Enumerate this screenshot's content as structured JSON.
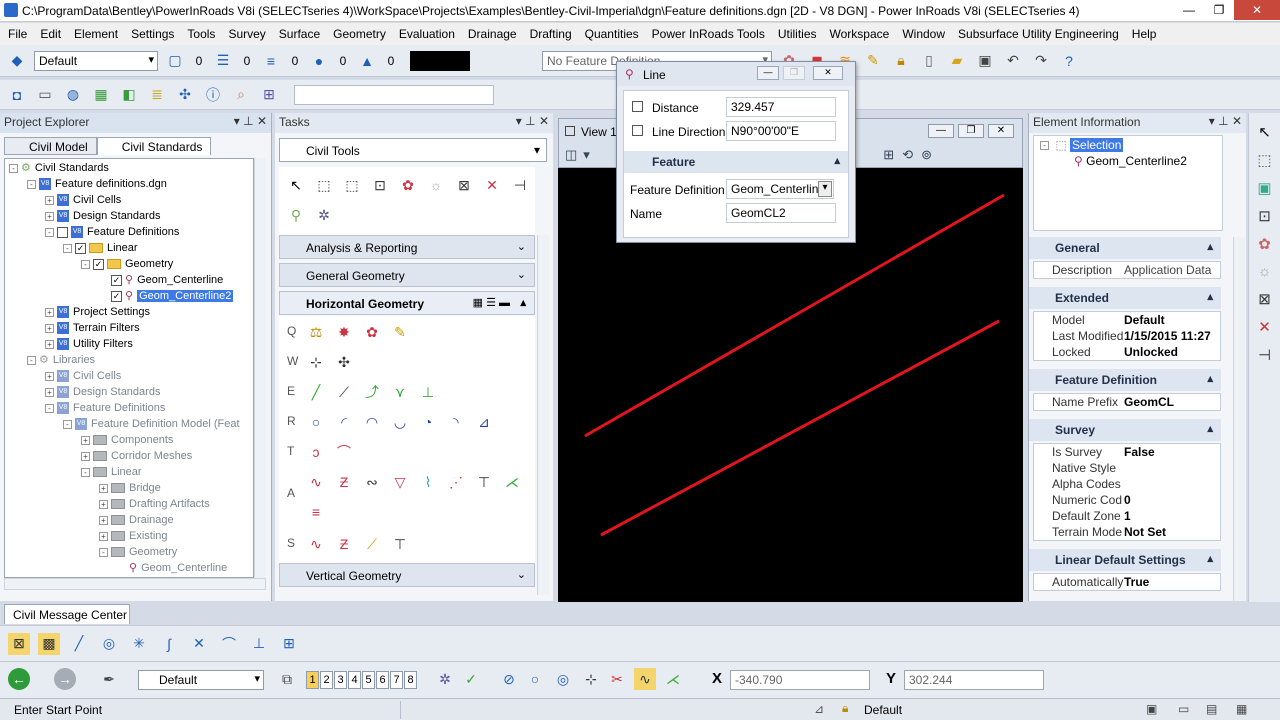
{
  "window": {
    "title": "C:\\ProgramData\\Bentley\\PowerInRoads V8i (SELECTseries 4)\\WorkSpace\\Projects\\Examples\\Bentley-Civil-Imperial\\dgn\\Feature definitions.dgn [2D - V8 DGN] - Power InRoads V8i (SELECTseries 4)",
    "minimize": "—",
    "maximize": "❐",
    "close": "✕"
  },
  "menu": [
    "File",
    "Edit",
    "Element",
    "Settings",
    "Tools",
    "Survey",
    "Surface",
    "Geometry",
    "Evaluation",
    "Drainage",
    "Drafting",
    "Quantities",
    "Power InRoads Tools",
    "Utilities",
    "Workspace",
    "Window",
    "Subsurface Utility Engineering",
    "Help"
  ],
  "toolbar1": {
    "level_combo": "Default",
    "counts": [
      "0",
      "0",
      "0",
      "0",
      "0"
    ],
    "feature_def_combo": "No Feature Definition"
  },
  "project_explorer": {
    "title": "Project Explorer",
    "tabs": [
      "Civil Model",
      "Civil Standards"
    ],
    "tree": [
      {
        "label": "Civil Standards",
        "indent": 0,
        "exp": "-",
        "icon": "civ",
        "gray": false
      },
      {
        "label": "Feature definitions.dgn",
        "indent": 1,
        "exp": "-",
        "icon": "v8",
        "gray": false
      },
      {
        "label": "Civil Cells",
        "indent": 2,
        "exp": "+",
        "icon": "v8",
        "gray": false
      },
      {
        "label": "Design Standards",
        "indent": 2,
        "exp": "+",
        "icon": "v8",
        "gray": false
      },
      {
        "label": "Feature Definitions",
        "indent": 2,
        "exp": "-",
        "icon": "v8",
        "chk": "",
        "gray": false
      },
      {
        "label": "Linear",
        "indent": 3,
        "exp": "-",
        "icon": "folder",
        "chk": "✓",
        "gray": false
      },
      {
        "label": "Geometry",
        "indent": 4,
        "exp": "-",
        "icon": "folder",
        "chk": "✓",
        "gray": false
      },
      {
        "label": "Geom_Centerline",
        "indent": 5,
        "exp": "",
        "icon": "feat",
        "chk": "✓",
        "gray": false
      },
      {
        "label": "Geom_Centerline2",
        "indent": 5,
        "exp": "",
        "icon": "feat",
        "chk": "✓",
        "gray": false,
        "selected": true
      },
      {
        "label": "Project Settings",
        "indent": 2,
        "exp": "+",
        "icon": "v8",
        "gray": false
      },
      {
        "label": "Terrain Filters",
        "indent": 2,
        "exp": "+",
        "icon": "v8",
        "gray": false
      },
      {
        "label": "Utility Filters",
        "indent": 2,
        "exp": "+",
        "icon": "v8",
        "gray": false
      },
      {
        "label": "Libraries",
        "indent": 1,
        "exp": "-",
        "icon": "lib",
        "gray": true
      },
      {
        "label": "Civil Cells",
        "indent": 2,
        "exp": "+",
        "icon": "v8g",
        "gray": true
      },
      {
        "label": "Design Standards",
        "indent": 2,
        "exp": "+",
        "icon": "v8g",
        "gray": true
      },
      {
        "label": "Feature Definitions",
        "indent": 2,
        "exp": "-",
        "icon": "v8g",
        "gray": true
      },
      {
        "label": "Feature Definition Model (Feat",
        "indent": 3,
        "exp": "-",
        "icon": "v8g",
        "gray": true
      },
      {
        "label": "Components",
        "indent": 4,
        "exp": "+",
        "icon": "folderg",
        "gray": true
      },
      {
        "label": "Corridor Meshes",
        "indent": 4,
        "exp": "+",
        "icon": "folderg",
        "gray": true
      },
      {
        "label": "Linear",
        "indent": 4,
        "exp": "-",
        "icon": "folderg",
        "gray": true
      },
      {
        "label": "Bridge",
        "indent": 5,
        "exp": "+",
        "icon": "folderg",
        "gray": true
      },
      {
        "label": "Drafting Artifacts",
        "indent": 5,
        "exp": "+",
        "icon": "folderg",
        "gray": true
      },
      {
        "label": "Drainage",
        "indent": 5,
        "exp": "+",
        "icon": "folderg",
        "gray": true
      },
      {
        "label": "Existing",
        "indent": 5,
        "exp": "+",
        "icon": "folderg",
        "gray": true
      },
      {
        "label": "Geometry",
        "indent": 5,
        "exp": "-",
        "icon": "folderg",
        "gray": true
      },
      {
        "label": "Geom_Centerline",
        "indent": 6,
        "exp": "",
        "icon": "feat",
        "gray": true
      }
    ]
  },
  "tasks": {
    "title": "Tasks",
    "dropdown": "Civil Tools",
    "sections": [
      "Analysis & Reporting",
      "General Geometry",
      "Horizontal Geometry",
      "Vertical Geometry"
    ],
    "row_labels": [
      "Q",
      "W",
      "E",
      "R",
      "T",
      "A",
      "S"
    ]
  },
  "view": {
    "title": "View 1"
  },
  "line_dialog": {
    "title": "Line",
    "distance_label": "Distance",
    "distance_value": "329.457",
    "direction_label": "Line Direction",
    "direction_value": "N90°00'00\"E",
    "section": "Feature",
    "feature_def_label": "Feature Definition",
    "feature_def_value": "Geom_Centerline",
    "name_label": "Name",
    "name_value": "GeomCL2"
  },
  "element_info": {
    "title": "Element Information",
    "selection": "Selection",
    "item": "Geom_Centerline2",
    "groups": [
      {
        "name": "General",
        "rows": [
          [
            "Description",
            "Application Data",
            false
          ]
        ]
      },
      {
        "name": "Extended",
        "rows": [
          [
            "Model",
            "Default",
            true
          ],
          [
            "Last Modified",
            "1/15/2015 11:27",
            true
          ],
          [
            "Locked",
            "Unlocked",
            true
          ]
        ]
      },
      {
        "name": "Feature Definition",
        "rows": [
          [
            "Name Prefix",
            "GeomCL",
            true
          ]
        ]
      },
      {
        "name": "Survey",
        "rows": [
          [
            "Is Survey",
            "False",
            true
          ],
          [
            "Native Style",
            "",
            true
          ],
          [
            "Alpha Codes",
            "",
            true
          ],
          [
            "Numeric Cod",
            "0",
            true
          ],
          [
            "Default Zone",
            "1",
            true
          ],
          [
            "Terrain Mode",
            "Not Set",
            true
          ]
        ]
      },
      {
        "name": "Linear Default Settings",
        "rows": [
          [
            "Automatically",
            "True",
            true
          ]
        ]
      }
    ]
  },
  "message_center": {
    "tab": "Civil Message Center"
  },
  "bottom_toolbar": {
    "style_combo": "Default",
    "view_numbers": [
      "1",
      "2",
      "3",
      "4",
      "5",
      "6",
      "7",
      "8"
    ],
    "x_label": "X",
    "x_value": "-340.790",
    "y_label": "Y",
    "y_value": "302.244"
  },
  "status": {
    "prompt": "Enter Start Point",
    "level": "Default"
  },
  "colors": {
    "line": "#e0151d",
    "selection": "#3d7ae5"
  }
}
